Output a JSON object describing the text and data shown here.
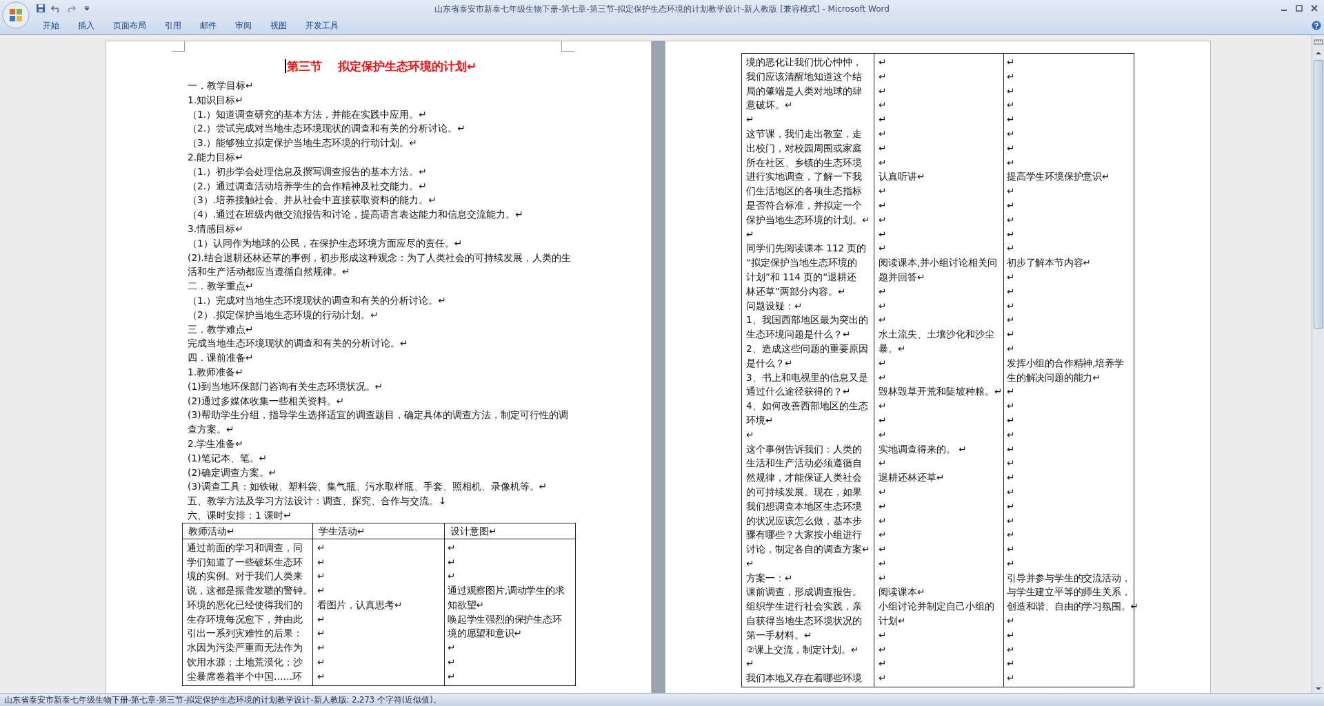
{
  "window": {
    "title": "山东省泰安市新泰七年级生物下册-第七章-第三节-拟定保护生态环境的计划教学设计-新人教版 [兼容模式] - Microsoft Word"
  },
  "ribbon_tabs": [
    {
      "label": "开始"
    },
    {
      "label": "插入"
    },
    {
      "label": "页面布局"
    },
    {
      "label": "引用"
    },
    {
      "label": "邮件"
    },
    {
      "label": "审阅"
    },
    {
      "label": "视图"
    },
    {
      "label": "开发工具"
    }
  ],
  "left_page": {
    "title": "第三节    拟定保护生态环境的计划↵",
    "lines": [
      "一．教学目标↵",
      "1.知识目标↵",
      "（1.）知道调查研究的基本方法，并能在实践中应用。↵",
      "（2.）尝试完成对当地生态环境现状的调查和有关的分析讨论。↵",
      "（3.）能够独立拟定保护当地生态环境的行动计划。↵",
      "2.能力目标↵",
      "（1.）初步学会处理信息及撰写调查报告的基本方法。↵",
      "（2.）通过调查活动培养学生的合作精神及社交能力。↵",
      "（3）.培养接触社会、并从社会中直接获取资料的能力。↵",
      "（4）.通过在班级内做交流报告和讨论，提高语言表达能力和信息交流能力。↵",
      "3.情感目标↵",
      "（1）认同作为地球的公民，在保护生态环境方面应尽的责任。↵",
      "(2).结合退耕还林还草的事例，初步形成这种观念：为了人类社会的可持续发展，人类的生活和生产活动都应当遵循自然规律。↵",
      "二．教学重点↵",
      "（1.）完成对当地生态环境现状的调查和有关的分析讨论。↵",
      "（2）.拟定保护当地生态环境的行动计划。↵",
      "三．教学难点↵",
      "完成当地生态环境现状的调查和有关的分析讨论。↵",
      "四．课前准备↵",
      "1.教师准备↵",
      "(1)到当地环保部门咨询有关生态环境状况。↵",
      "(2)通过多媒体收集一些相关资料。↵",
      "(3)帮助学生分组，指导学生选择适宜的调查题目，确定具体的调查方法，制定可行性的调查方案。↵",
      "2.学生准备↵",
      "(1)笔记本、笔。↵",
      "(2)确定调查方案。↵",
      "(3)调查工具：如铁锹、塑料袋、集气瓶、污水取样瓶、手套、照相机、录像机等。↵",
      "五、教学方法及学习方法设计：调查、探究、合作与交流。↓",
      "六、课时安排：1 课时↵"
    ],
    "table": {
      "columns": [
        "教师活动↵",
        "学生活动↵",
        "设计意图↵"
      ],
      "rows": [
        [
          "通过前面的学习和调查，同",
          "↵",
          "↵"
        ],
        [
          "学们知道了一些破坏生态环",
          "↵",
          "↵"
        ],
        [
          "境的实例。对于我们人类来",
          "↵",
          "↵"
        ],
        [
          "说，这都是振聋发聩的警钟。",
          "↵",
          "通过观察图片,调动学生的求"
        ],
        [
          "环境的恶化已经使得我们的",
          "看图片，认真思考↵",
          "知欲望↵"
        ],
        [
          "生存环境每况愈下，并由此",
          "↵",
          "唤起学生强烈的保护生态环"
        ],
        [
          "引出一系列灾难性的后果：",
          "↵",
          "境的愿望和意识↵"
        ],
        [
          "水因为污染严重而无法作为",
          "↵",
          "↵"
        ],
        [
          "饮用水源；土地荒漠化；沙",
          "↵",
          "↵"
        ],
        [
          "尘暴席卷着半个中国……环",
          "↵",
          "↵"
        ]
      ]
    }
  },
  "right_page": {
    "table": {
      "rows": [
        [
          "境的恶化让我们忧心忡忡，",
          "↵",
          "↵"
        ],
        [
          "我们应该清醒地知道这个结",
          "↵",
          "↵"
        ],
        [
          "局的肇端是人类对地球的肆",
          "↵",
          "↵"
        ],
        [
          "意破坏。↵",
          "↵",
          "↵"
        ],
        [
          "↵",
          "↵",
          "↵"
        ],
        [
          "这节课，我们走出教室，走",
          "↵",
          "↵"
        ],
        [
          "出校门，对校园周围或家庭",
          "↵",
          "↵"
        ],
        [
          "所在社区、乡镇的生态环境",
          "↵",
          "↵"
        ],
        [
          "进行实地调查，了解一下我",
          "认真听讲↵",
          "提高学生环境保护意识↵"
        ],
        [
          "们生活地区的各项生态指标",
          "↵",
          "↵"
        ],
        [
          "是否符合标准，并拟定一个",
          "↵",
          "↵"
        ],
        [
          "保护当地生态环境的计划。↵",
          "↵",
          "↵"
        ],
        [
          "↵",
          "↵",
          "↵"
        ],
        [
          "同学们先阅读课本 112 页的",
          "↵",
          "↵"
        ],
        [
          "“拟定保护当地生态环境的",
          "阅读课本,并小组讨论相关问",
          "初步了解本节内容↵"
        ],
        [
          "计划”和 114 页的“退耕还",
          "题并回答↵",
          "↵"
        ],
        [
          "林还草”两部分内容。↵",
          "↵",
          "↵"
        ],
        [
          "问题设疑：↵",
          "↵",
          "↵"
        ],
        [
          "1、我国西部地区最为突出的",
          "↵",
          "↵"
        ],
        [
          "生态环境问题是什么？↵",
          "水土流失、土壤沙化和沙尘",
          "↵"
        ],
        [
          "2、造成这些问题的重要原因",
          "暴。↵",
          "↵"
        ],
        [
          "是什么？↵",
          "↵",
          "发挥小组的合作精神,培养学"
        ],
        [
          "3、书上和电视里的信息又是",
          "↵",
          "生的解决问题的能力↵"
        ],
        [
          "通过什么途径获得的？↵",
          "毁林毁草开荒和陡坡种粮。↵",
          "↵"
        ],
        [
          "4、如何改善西部地区的生态",
          "↵",
          "↵"
        ],
        [
          "环境↵",
          "↵",
          "↵"
        ],
        [
          "↵",
          "↵",
          "↵"
        ],
        [
          "这个事例告诉我们：人类的",
          "实地调查得来的。 ↵",
          "↵"
        ],
        [
          "生活和生产活动必须遵循自",
          "↵",
          "↵"
        ],
        [
          "然规律，才能保证人类社会",
          "退耕还林还草↵",
          "↵"
        ],
        [
          "的可持续发展。现在，如果",
          "↵",
          "↵"
        ],
        [
          "我们想调查本地区生态环境",
          "↵",
          "↵"
        ],
        [
          "的状况应该怎么做，基本步",
          "↵",
          "↵"
        ],
        [
          "骤有哪些？大家按小组进行",
          "↵",
          "↵"
        ],
        [
          "讨论，制定各自的调查方案↵",
          "↵",
          "↵"
        ],
        [
          "↵",
          "↵",
          "↵"
        ],
        [
          "方案一：↵",
          "↵",
          "引导并参与学生的交流活动，"
        ],
        [
          "课前调查，形成调查报告。",
          "阅读课本↵",
          "与学生建立平等的师生关系，"
        ],
        [
          "组织学生进行社会实践，亲",
          "小组讨论并制定自己小组的",
          "创造和谐、自由的学习氛围。↵"
        ],
        [
          "自获得当地生态环境状况的",
          "计划↵",
          "↵"
        ],
        [
          "第一手材料。↵",
          "↵",
          "↵"
        ],
        [
          "②课上交流，制定计划。↵",
          "↵",
          "↵"
        ],
        [
          "↵",
          "↵",
          "↵"
        ],
        [
          "我们本地又存在着哪些环境",
          "↵",
          "↵"
        ]
      ]
    }
  },
  "status_bar": {
    "text": "山东省泰安市新泰七年级生物下册-第七章-第三节-拟定保护生态环境的计划教学设计-新人教版: 2,273 个字符(近似值)。"
  }
}
